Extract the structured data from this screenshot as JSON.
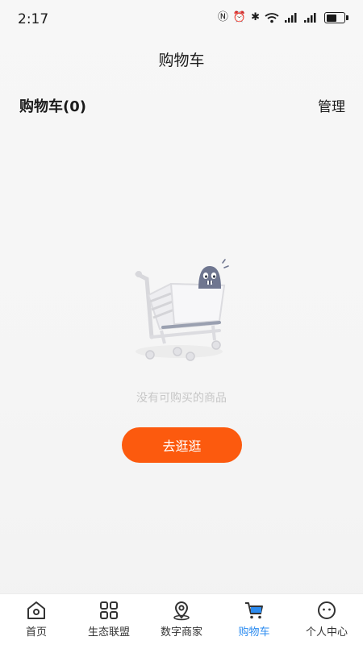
{
  "status_bar": {
    "time": "2:17"
  },
  "header": {
    "title": "购物车"
  },
  "cart": {
    "count_label": "购物车(0)",
    "manage_label": "管理"
  },
  "empty_state": {
    "message": "没有可购买的商品",
    "button_label": "去逛逛"
  },
  "tab_bar": {
    "items": [
      {
        "label": "首页",
        "icon": "home-icon"
      },
      {
        "label": "生态联盟",
        "icon": "grid-icon"
      },
      {
        "label": "数字商家",
        "icon": "location-pin-icon"
      },
      {
        "label": "购物车",
        "icon": "cart-icon"
      },
      {
        "label": "个人中心",
        "icon": "smiley-icon"
      }
    ],
    "active_index": 3
  },
  "colors": {
    "accent": "#fc5a0e",
    "active_tab": "#2d8cf0"
  }
}
